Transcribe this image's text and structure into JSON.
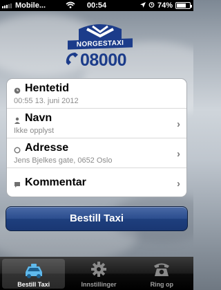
{
  "status_bar": {
    "carrier": "Mobile...",
    "time": "00:54",
    "battery": "74%",
    "battery_level": 0.74
  },
  "logo": {
    "brand": "NORGESTAXI",
    "phone": "08000"
  },
  "form": {
    "rows": [
      {
        "title": "Hentetid",
        "subtitle": "00:55 13. juni 2012"
      },
      {
        "title": "Navn",
        "subtitle": "Ikke opplyst"
      },
      {
        "title": "Adresse",
        "subtitle": "Jens Bjelkes gate, 0652 Oslo"
      },
      {
        "title": "Kommentar",
        "subtitle": ""
      }
    ],
    "chevron": "›"
  },
  "order_button": {
    "label": "Bestill Taxi"
  },
  "tabs": [
    {
      "label": "Bestill Taxi",
      "icon": "taxi-icon",
      "active": true
    },
    {
      "label": "Innstillinger",
      "icon": "gear-icon",
      "active": false
    },
    {
      "label": "Ring op",
      "icon": "phone-icon",
      "active": false
    }
  ],
  "colors": {
    "brand_blue": "#1c3c8a",
    "button_blue": "#2b4d8e",
    "tab_active_icon": "#5fb9ec"
  }
}
